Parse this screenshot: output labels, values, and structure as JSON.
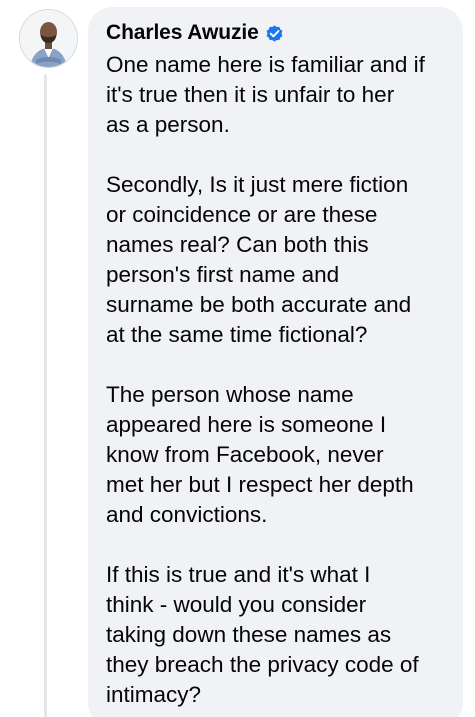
{
  "comment": {
    "author": "Charles Awuzie",
    "verified_icon": "verified-badge-icon",
    "paragraphs": [
      "One name here is familiar and if\nit's true then it is unfair to her\nas a person.",
      "Secondly, Is it just mere fiction\nor coincidence or are these\nnames real? Can both this\nperson's first name and\nsurname be both accurate and\nat the same time fictional?",
      "The person whose name\nappeared here is someone I\nknow from Facebook, never\nmet her but I respect her depth\nand convictions.",
      "If this is true and it's what I\nthink - would you consider\ntaking down these names as\nthey breach the privacy code of\nintimacy?"
    ]
  },
  "colors": {
    "bubble": "#f0f2f5",
    "text": "#050505",
    "verified": "#1877f2",
    "thread_line": "#e4e6ea"
  }
}
